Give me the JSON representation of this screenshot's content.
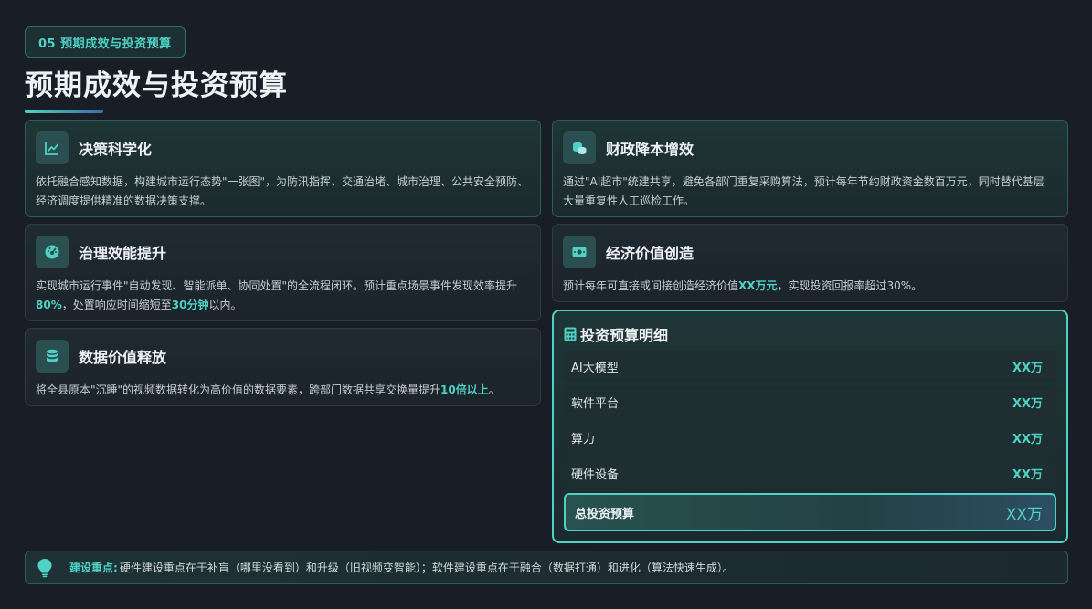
{
  "section_tag": "05  预期成效与投资预算",
  "page_title": "预期成效与投资预算",
  "cards": {
    "decision": {
      "title": "决策科学化",
      "line1": "依托融合感知数据，构建城市运行态势\"一张图\"，为防汛指挥、交通治堵、城市治理、公共安全预防、",
      "line2": "经济调度提供精准的数据决策支撑。"
    },
    "finance": {
      "title": "财政降本增效",
      "line1": "通过\"AI超市\"统建共享，避免各部门重复采购算法，预计每年节约财政资金数百万元，同时替代基层",
      "line2": "大量重复性人工巡检工作。"
    },
    "governance": {
      "title": "治理效能提升",
      "line1": "实现城市运行事件\"自动发现、智能派单、协同处置\"的全流程闭环。预计重点场景事件发现效率提升",
      "line2_hl1": "80%",
      "line2_mid": "，处置响应时间缩短至",
      "line2_hl2": "30分钟",
      "line2_end": "以内。"
    },
    "economy": {
      "title": "经济价值创造",
      "pre": "预计每年可直接或间接创造经济价值",
      "hl": "XX万元",
      "post": "，实现投资回报率超过30%。"
    },
    "data_value": {
      "title": "数据价值释放",
      "pre": "将全县原本\"沉睡\"的视频数据转化为高价值的数据要素，跨部门数据共享交换量提升",
      "hl": "10倍以上",
      "post": "。"
    }
  },
  "budget": {
    "title": "投资预算明细",
    "rows": [
      {
        "label": "AI大模型",
        "value": "XX万"
      },
      {
        "label": "软件平台",
        "value": "XX万"
      },
      {
        "label": "算力",
        "value": "XX万"
      },
      {
        "label": "硬件设备",
        "value": "XX万"
      }
    ],
    "total": {
      "label": "总投资预算",
      "value": "XX万"
    }
  },
  "footer": {
    "key": "建设重点:",
    "text": "硬件建设重点在于补盲（哪里没看到）和升级（旧视频变智能）；软件建设重点在于融合（数据打通）和进化（算法快速生成）。"
  },
  "colors": {
    "accent": "#4fd1c5",
    "background": "#191d26"
  },
  "icons": [
    "chart-line-icon",
    "coins-icon",
    "gauge-icon",
    "money-bill-icon",
    "database-icon",
    "calculator-icon",
    "lightbulb-icon"
  ]
}
